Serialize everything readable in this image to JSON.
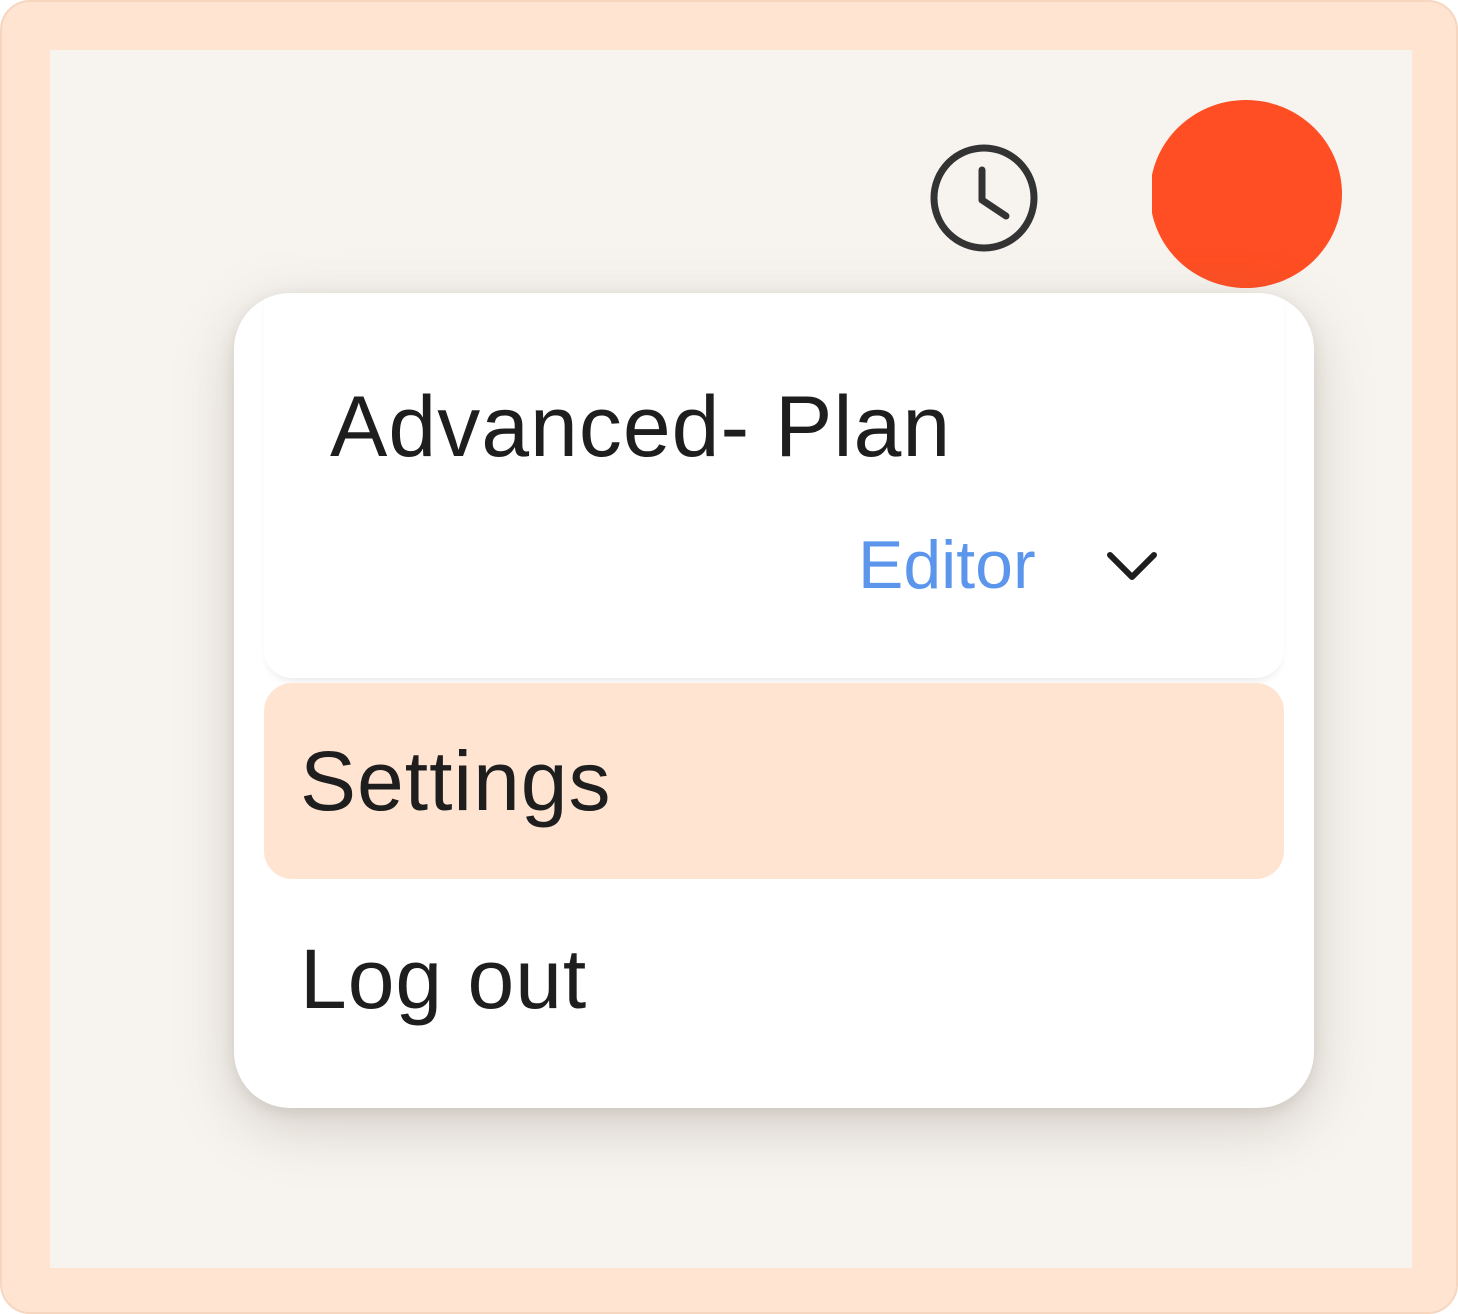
{
  "header": {
    "history_icon": "clock-icon",
    "avatar_color": "#ff4e23"
  },
  "menu": {
    "plan_title": "Advanced- Plan",
    "role_label": "Editor",
    "role_icon": "chevron-down-icon",
    "items": [
      {
        "label": "Settings",
        "active": true
      },
      {
        "label": "Log out",
        "active": false
      }
    ]
  },
  "colors": {
    "frame": "#ffe4d2",
    "background": "#f7f4ef",
    "accent_link": "#5b96ec",
    "highlight": "#ffe4d2"
  }
}
